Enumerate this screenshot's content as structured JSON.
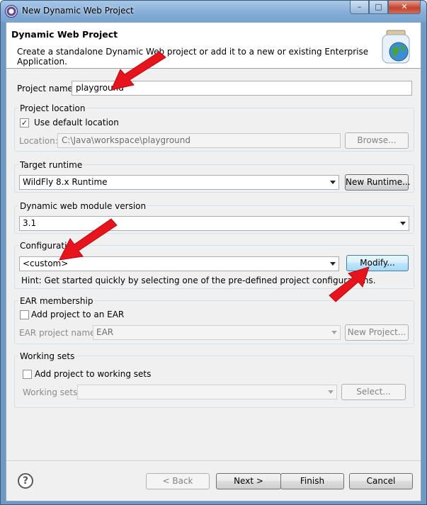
{
  "window": {
    "title": "New Dynamic Web Project",
    "controls": {
      "minimize": "–",
      "maximize": "□",
      "close": "✕"
    }
  },
  "header": {
    "title": "Dynamic Web Project",
    "description": "Create a standalone Dynamic Web project or add it to a new or existing Enterprise Application."
  },
  "project_name": {
    "label": "Project name:",
    "value": "playground"
  },
  "project_location": {
    "group_title": "Project location",
    "use_default_label": "Use default location",
    "use_default_checked": true,
    "location_label": "Location:",
    "location_value": "C:\\Java\\workspace\\playground",
    "browse_label": "Browse..."
  },
  "target_runtime": {
    "group_title": "Target runtime",
    "selected": "WildFly 8.x Runtime",
    "new_runtime_label": "New Runtime..."
  },
  "web_module": {
    "group_title": "Dynamic web module version",
    "selected": "3.1"
  },
  "configuration": {
    "group_title": "Configuration",
    "selected": "<custom>",
    "modify_label": "Modify...",
    "hint": "Hint: Get started quickly by selecting one of the pre-defined project configurations."
  },
  "ear_membership": {
    "group_title": "EAR membership",
    "add_label": "Add project to an EAR",
    "add_checked": false,
    "ear_name_label": "EAR project name:",
    "ear_name_value": "EAR",
    "new_project_label": "New Project..."
  },
  "working_sets": {
    "group_title": "Working sets",
    "add_label": "Add project to working sets",
    "add_checked": false,
    "sets_label": "Working sets:",
    "sets_value": "",
    "select_label": "Select..."
  },
  "footer": {
    "help_icon": "?",
    "back_label": "< Back",
    "next_label": "Next >",
    "finish_label": "Finish",
    "cancel_label": "Cancel"
  },
  "colors": {
    "annotation_arrow": "#e8141c",
    "hot_button": "#3c7fb1"
  },
  "icons": [
    "eclipse-icon",
    "jar-globe-icon",
    "help-icon",
    "checkmark-icon",
    "dropdown-arrow-icon"
  ]
}
